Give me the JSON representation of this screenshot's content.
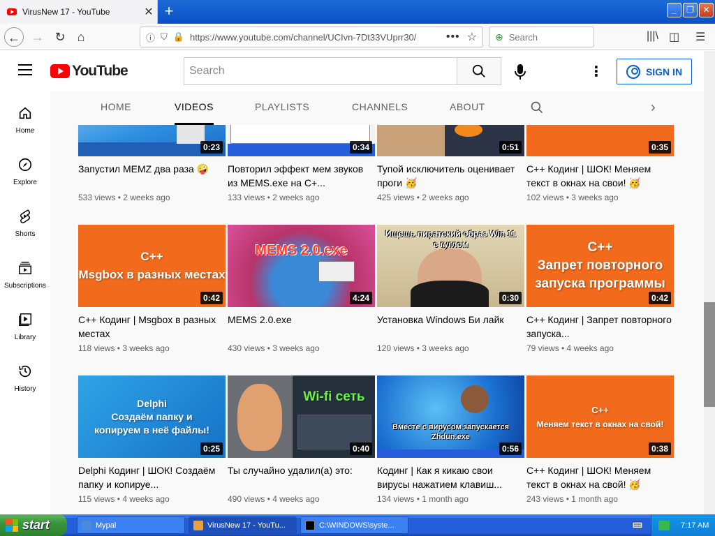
{
  "browser": {
    "tab_title": "VirusNew 17 - YouTube",
    "url": "https://www.youtube.com/channel/UCIvn-7Dt33VUprr30/",
    "search_placeholder": "Search"
  },
  "youtube": {
    "logo_text": "YouTube",
    "search_placeholder": "Search",
    "sign_in_label": "SIGN IN"
  },
  "sidebar": {
    "items": [
      {
        "label": "Home",
        "icon": "home-icon"
      },
      {
        "label": "Explore",
        "icon": "compass-icon"
      },
      {
        "label": "Shorts",
        "icon": "shorts-icon"
      },
      {
        "label": "Subscriptions",
        "icon": "subscriptions-icon"
      },
      {
        "label": "Library",
        "icon": "library-icon"
      },
      {
        "label": "History",
        "icon": "history-icon"
      }
    ]
  },
  "channel_tabs": [
    "HOME",
    "VIDEOS",
    "PLAYLISTS",
    "CHANNELS",
    "ABOUT"
  ],
  "active_tab": "VIDEOS",
  "videos": [
    {
      "title": "Запустил MEMZ два раза 🤪",
      "meta": "533 views • 2 weeks ago",
      "duration": "0:23"
    },
    {
      "title": "Повторил эффект мем звуков из MEMS.exe на C+...",
      "meta": "133 views • 2 weeks ago",
      "duration": "0:34"
    },
    {
      "title": "Тупой исключитель оценивает проги 🥳",
      "meta": "425 views • 2 weeks ago",
      "duration": "0:51"
    },
    {
      "title": "C++ Кодинг | ШОК! Меняем текст в окнах на свои! 🥳",
      "meta": "102 views • 3 weeks ago",
      "duration": "0:35"
    },
    {
      "title": "C++ Кодинг | Msgbox в разных местах",
      "meta": "118 views • 3 weeks ago",
      "duration": "0:42",
      "thumb_lines": [
        "C++",
        "Msgbox в разных местах"
      ]
    },
    {
      "title": "MEMS 2.0.exe",
      "meta": "430 views • 3 weeks ago",
      "duration": "4:24",
      "thumb_lines": [
        "MEMS 2.0.exe"
      ]
    },
    {
      "title": "Установка Windows Би лайк",
      "meta": "120 views • 3 weeks ago",
      "duration": "0:30",
      "thumb_lines": [
        "Ищешь пиратский образ Win 11",
        "с гуглом"
      ]
    },
    {
      "title": "C++ Кодинг | Запрет повторного запуска...",
      "meta": "79 views • 4 weeks ago",
      "duration": "0:42",
      "thumb_lines": [
        "C++",
        "Запрет повторного",
        "запуска программы"
      ]
    },
    {
      "title": "Delphi Кодинг | ШОК! Создаём папку и копируе...",
      "meta": "115 views • 4 weeks ago",
      "duration": "0:25",
      "thumb_lines": [
        "Delphi",
        "Создаём папку и",
        "копируем в неё файлы!"
      ]
    },
    {
      "title": "Ты случайно удалил(а) это:",
      "meta": "490 views • 4 weeks ago",
      "duration": "0:40",
      "thumb_lines": [
        "Wi-fi сеть"
      ]
    },
    {
      "title": "Кодинг | Как я кикаю свои вирусы нажатием клавиш...",
      "meta": "134 views • 1 month ago",
      "duration": "0:56",
      "thumb_lines": [
        "Вместе с вирусом запускается",
        "Zhdun.exe"
      ]
    },
    {
      "title": "C++ Кодинг | ШОК! Меняем текст в окнах на свой! 🥳",
      "meta": "243 views • 1 month ago",
      "duration": "0:38",
      "thumb_lines": [
        "C++",
        "Меняем текст в окнах на свой!"
      ]
    }
  ],
  "taskbar": {
    "start_label": "start",
    "tasks": [
      "Mypal",
      "VirusNew 17 - YouTu...",
      "C:\\WINDOWS\\syste..."
    ],
    "clock": "7:17 AM"
  },
  "colors": {
    "youtube_red": "#ff0000",
    "signin_blue": "#065fd4",
    "thumb_orange": "#f26b1d"
  }
}
